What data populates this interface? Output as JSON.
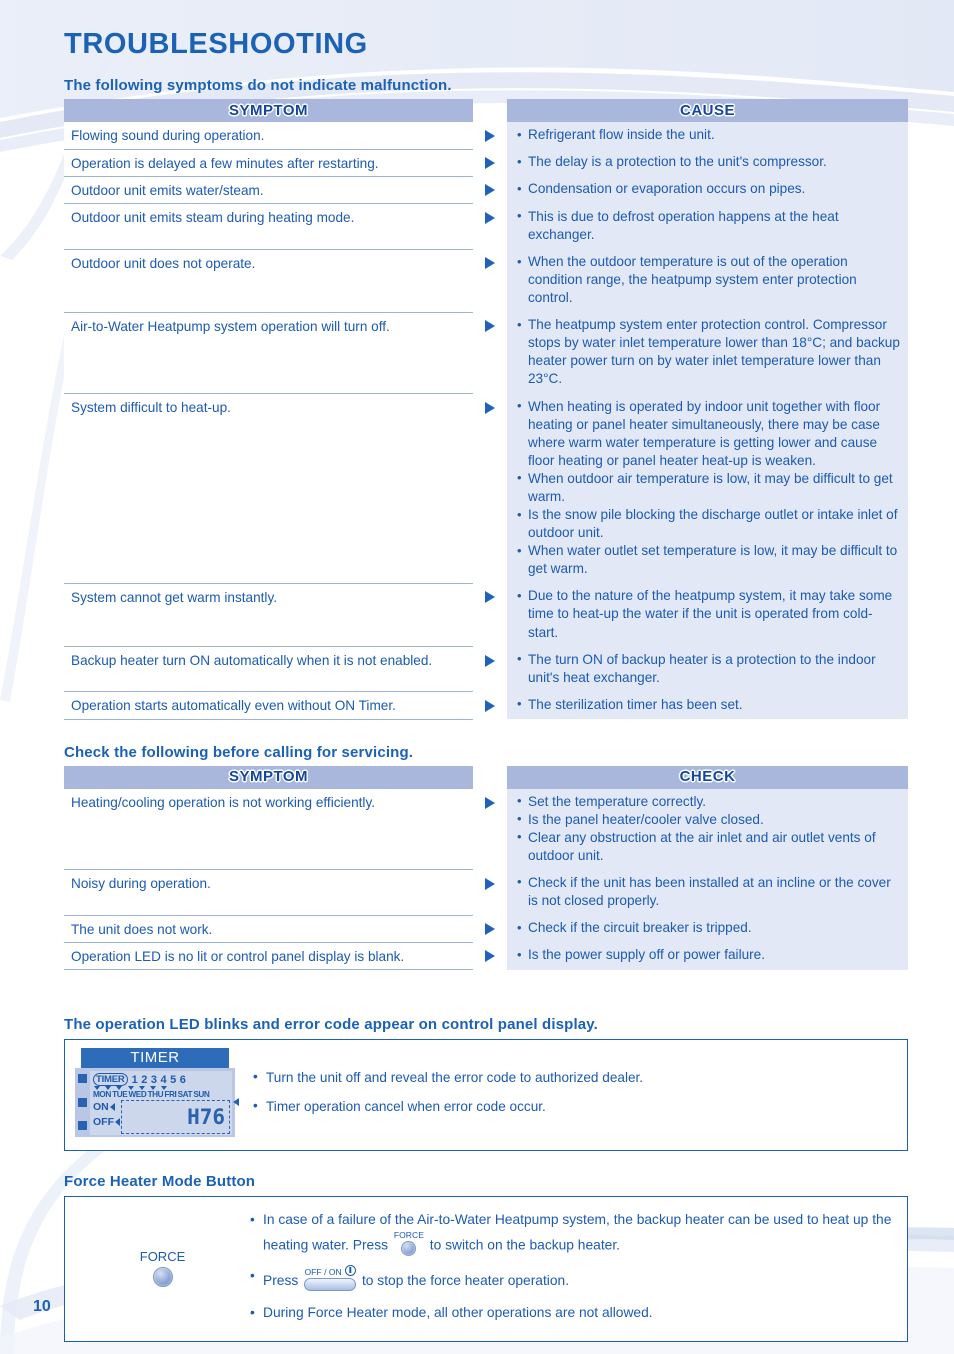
{
  "document": {
    "title": "TROUBLESHOOTING",
    "page_number": "10"
  },
  "colors": {
    "accent_blue": "#1b62b5",
    "header_bar": "#aab7dc",
    "cause_cell_bg": "#e3e8f6",
    "text_blue": "#1c5bb0"
  },
  "section1": {
    "heading": "The following symptoms do not indicate malfunction.",
    "columns": {
      "left": "SYMPTOM",
      "right": "CAUSE"
    },
    "rows": [
      {
        "symptom": "Flowing sound during operation.",
        "causes": [
          "Refrigerant flow inside the unit."
        ]
      },
      {
        "symptom": "Operation is delayed a few minutes after restarting.",
        "causes": [
          "The delay is a protection to the unit's compressor."
        ]
      },
      {
        "symptom": "Outdoor unit emits water/steam.",
        "causes": [
          "Condensation or evaporation occurs on pipes."
        ]
      },
      {
        "symptom": "Outdoor unit emits steam during heating mode.",
        "causes": [
          "This is due to defrost operation happens at the heat exchanger."
        ]
      },
      {
        "symptom": "Outdoor unit does not operate.",
        "causes": [
          "When the outdoor temperature is out of the operation condition range, the heatpump system enter protection control."
        ]
      },
      {
        "symptom": "Air-to-Water Heatpump system operation will turn off.",
        "causes": [
          "The heatpump system enter protection control. Compressor stops by water inlet temperature lower than 18°C; and backup heater power turn on by water inlet temperature lower than 23°C."
        ]
      },
      {
        "symptom": "System difficult to heat-up.",
        "causes": [
          "When heating is operated by indoor unit together with floor heating or panel heater simultaneously, there may be case where warm water temperature is getting lower and cause floor heating or panel heater heat-up is weaken.",
          "When outdoor air temperature is low, it may be difficult to get warm.",
          "Is the snow pile blocking the discharge outlet or intake inlet of outdoor unit.",
          "When water outlet set temperature is low, it may be difficult to get warm."
        ]
      },
      {
        "symptom": "System cannot get warm instantly.",
        "causes": [
          "Due to the nature of the heatpump system, it may take some time to heat-up the water if the unit is operated from cold-start."
        ]
      },
      {
        "symptom": "Backup heater turn ON automatically when it is not enabled.",
        "causes": [
          "The turn ON of backup heater is a protection to the indoor unit's heat exchanger."
        ]
      },
      {
        "symptom": "Operation starts automatically even without ON Timer.",
        "causes": [
          "The sterilization timer has been set."
        ]
      }
    ]
  },
  "section2": {
    "heading": "Check the following before calling for servicing.",
    "columns": {
      "left": "SYMPTOM",
      "right": "CHECK"
    },
    "rows": [
      {
        "symptom": "Heating/cooling operation is not working efficiently.",
        "causes": [
          "Set the temperature correctly.",
          "Is the panel heater/cooler valve closed.",
          "Clear any obstruction at the air inlet and air outlet vents of outdoor unit."
        ]
      },
      {
        "symptom": "Noisy during operation.",
        "causes": [
          "Check if the unit has been installed at an incline or the cover is not closed properly."
        ]
      },
      {
        "symptom": "The unit does not work.",
        "causes": [
          "Check if the circuit breaker is tripped."
        ]
      },
      {
        "symptom": "Operation LED is no lit or control panel display is blank.",
        "causes": [
          "Is the power supply off or power failure."
        ]
      }
    ]
  },
  "section3": {
    "heading": "The operation LED blinks and error code appear on control panel display.",
    "lcd": {
      "title": "TIMER",
      "timer_badge": "TIMER",
      "numbers": [
        "1",
        "2",
        "3",
        "4",
        "5",
        "6"
      ],
      "days": [
        "MON",
        "TUE",
        "WED",
        "THU",
        "FRI",
        "SAT",
        "SUN"
      ],
      "on_label": "ON",
      "off_label": "OFF",
      "error_code": "H76"
    },
    "notes": [
      "Turn the unit off and reveal the error code to authorized dealer.",
      "Timer operation cancel when error code occur."
    ]
  },
  "section4": {
    "heading": "Force Heater Mode Button",
    "button_label": "FORCE",
    "inline_force_caption": "FORCE",
    "inline_offon_caption": "OFF / ON",
    "notes": {
      "line1_a": "In case of a failure of the Air-to-Water Heatpump system, the backup heater can be used to heat up the heating water. Press",
      "line1_b": "to switch on the backup heater.",
      "line2_a": "Press",
      "line2_b": "to stop the force heater operation.",
      "line3": "During Force Heater mode, all other operations are not allowed."
    }
  }
}
